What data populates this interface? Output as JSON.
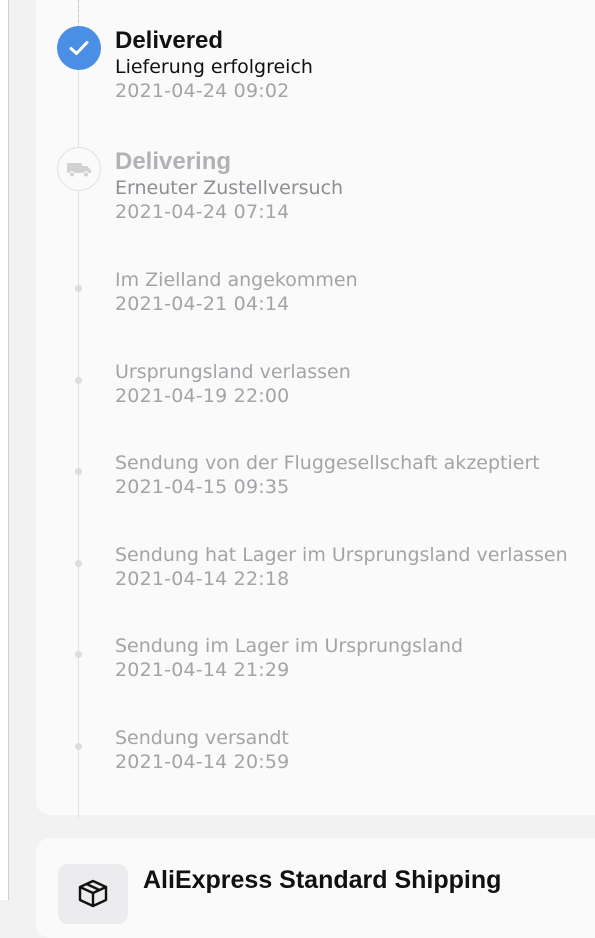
{
  "tracking": {
    "major_events": [
      {
        "status": "Delivered",
        "description": "Lieferung erfolgreich",
        "time": "2021-04-24 09:02",
        "icon": "checkmark-icon",
        "color": "#4a8ee6"
      },
      {
        "status": "Delivering",
        "description": "Erneuter Zustellversuch",
        "time": "2021-04-24 07:14",
        "icon": "truck-icon"
      }
    ],
    "events": [
      {
        "description": "Im Zielland angekommen",
        "time": "2021-04-21 04:14"
      },
      {
        "description": "Ursprungsland verlassen",
        "time": "2021-04-19 22:00"
      },
      {
        "description": "Sendung von der Fluggesellschaft akzeptiert",
        "time": "2021-04-15 09:35"
      },
      {
        "description": "Sendung hat Lager im Ursprungsland verlassen",
        "time": "2021-04-14 22:18"
      },
      {
        "description": "Sendung im Lager im Ursprungsland",
        "time": "2021-04-14 21:29"
      },
      {
        "description": "Sendung versandt",
        "time": "2021-04-14 20:59"
      }
    ]
  },
  "shipping": {
    "method": "AliExpress Standard Shipping",
    "icon": "package-icon"
  }
}
